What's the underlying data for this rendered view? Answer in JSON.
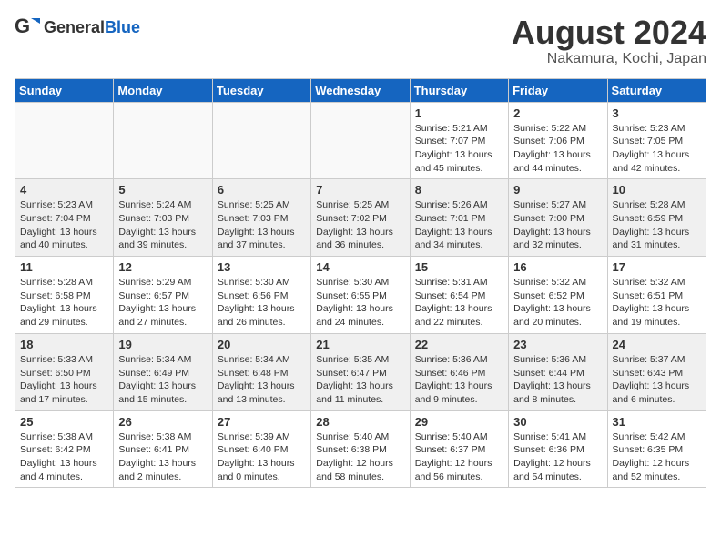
{
  "header": {
    "logo_general": "General",
    "logo_blue": "Blue",
    "month_year": "August 2024",
    "location": "Nakamura, Kochi, Japan"
  },
  "weekdays": [
    "Sunday",
    "Monday",
    "Tuesday",
    "Wednesday",
    "Thursday",
    "Friday",
    "Saturday"
  ],
  "weeks": [
    [
      {
        "day": "",
        "info": ""
      },
      {
        "day": "",
        "info": ""
      },
      {
        "day": "",
        "info": ""
      },
      {
        "day": "",
        "info": ""
      },
      {
        "day": "1",
        "info": "Sunrise: 5:21 AM\nSunset: 7:07 PM\nDaylight: 13 hours\nand 45 minutes."
      },
      {
        "day": "2",
        "info": "Sunrise: 5:22 AM\nSunset: 7:06 PM\nDaylight: 13 hours\nand 44 minutes."
      },
      {
        "day": "3",
        "info": "Sunrise: 5:23 AM\nSunset: 7:05 PM\nDaylight: 13 hours\nand 42 minutes."
      }
    ],
    [
      {
        "day": "4",
        "info": "Sunrise: 5:23 AM\nSunset: 7:04 PM\nDaylight: 13 hours\nand 40 minutes."
      },
      {
        "day": "5",
        "info": "Sunrise: 5:24 AM\nSunset: 7:03 PM\nDaylight: 13 hours\nand 39 minutes."
      },
      {
        "day": "6",
        "info": "Sunrise: 5:25 AM\nSunset: 7:03 PM\nDaylight: 13 hours\nand 37 minutes."
      },
      {
        "day": "7",
        "info": "Sunrise: 5:25 AM\nSunset: 7:02 PM\nDaylight: 13 hours\nand 36 minutes."
      },
      {
        "day": "8",
        "info": "Sunrise: 5:26 AM\nSunset: 7:01 PM\nDaylight: 13 hours\nand 34 minutes."
      },
      {
        "day": "9",
        "info": "Sunrise: 5:27 AM\nSunset: 7:00 PM\nDaylight: 13 hours\nand 32 minutes."
      },
      {
        "day": "10",
        "info": "Sunrise: 5:28 AM\nSunset: 6:59 PM\nDaylight: 13 hours\nand 31 minutes."
      }
    ],
    [
      {
        "day": "11",
        "info": "Sunrise: 5:28 AM\nSunset: 6:58 PM\nDaylight: 13 hours\nand 29 minutes."
      },
      {
        "day": "12",
        "info": "Sunrise: 5:29 AM\nSunset: 6:57 PM\nDaylight: 13 hours\nand 27 minutes."
      },
      {
        "day": "13",
        "info": "Sunrise: 5:30 AM\nSunset: 6:56 PM\nDaylight: 13 hours\nand 26 minutes."
      },
      {
        "day": "14",
        "info": "Sunrise: 5:30 AM\nSunset: 6:55 PM\nDaylight: 13 hours\nand 24 minutes."
      },
      {
        "day": "15",
        "info": "Sunrise: 5:31 AM\nSunset: 6:54 PM\nDaylight: 13 hours\nand 22 minutes."
      },
      {
        "day": "16",
        "info": "Sunrise: 5:32 AM\nSunset: 6:52 PM\nDaylight: 13 hours\nand 20 minutes."
      },
      {
        "day": "17",
        "info": "Sunrise: 5:32 AM\nSunset: 6:51 PM\nDaylight: 13 hours\nand 19 minutes."
      }
    ],
    [
      {
        "day": "18",
        "info": "Sunrise: 5:33 AM\nSunset: 6:50 PM\nDaylight: 13 hours\nand 17 minutes."
      },
      {
        "day": "19",
        "info": "Sunrise: 5:34 AM\nSunset: 6:49 PM\nDaylight: 13 hours\nand 15 minutes."
      },
      {
        "day": "20",
        "info": "Sunrise: 5:34 AM\nSunset: 6:48 PM\nDaylight: 13 hours\nand 13 minutes."
      },
      {
        "day": "21",
        "info": "Sunrise: 5:35 AM\nSunset: 6:47 PM\nDaylight: 13 hours\nand 11 minutes."
      },
      {
        "day": "22",
        "info": "Sunrise: 5:36 AM\nSunset: 6:46 PM\nDaylight: 13 hours\nand 9 minutes."
      },
      {
        "day": "23",
        "info": "Sunrise: 5:36 AM\nSunset: 6:44 PM\nDaylight: 13 hours\nand 8 minutes."
      },
      {
        "day": "24",
        "info": "Sunrise: 5:37 AM\nSunset: 6:43 PM\nDaylight: 13 hours\nand 6 minutes."
      }
    ],
    [
      {
        "day": "25",
        "info": "Sunrise: 5:38 AM\nSunset: 6:42 PM\nDaylight: 13 hours\nand 4 minutes."
      },
      {
        "day": "26",
        "info": "Sunrise: 5:38 AM\nSunset: 6:41 PM\nDaylight: 13 hours\nand 2 minutes."
      },
      {
        "day": "27",
        "info": "Sunrise: 5:39 AM\nSunset: 6:40 PM\nDaylight: 13 hours\nand 0 minutes."
      },
      {
        "day": "28",
        "info": "Sunrise: 5:40 AM\nSunset: 6:38 PM\nDaylight: 12 hours\nand 58 minutes."
      },
      {
        "day": "29",
        "info": "Sunrise: 5:40 AM\nSunset: 6:37 PM\nDaylight: 12 hours\nand 56 minutes."
      },
      {
        "day": "30",
        "info": "Sunrise: 5:41 AM\nSunset: 6:36 PM\nDaylight: 12 hours\nand 54 minutes."
      },
      {
        "day": "31",
        "info": "Sunrise: 5:42 AM\nSunset: 6:35 PM\nDaylight: 12 hours\nand 52 minutes."
      }
    ]
  ]
}
